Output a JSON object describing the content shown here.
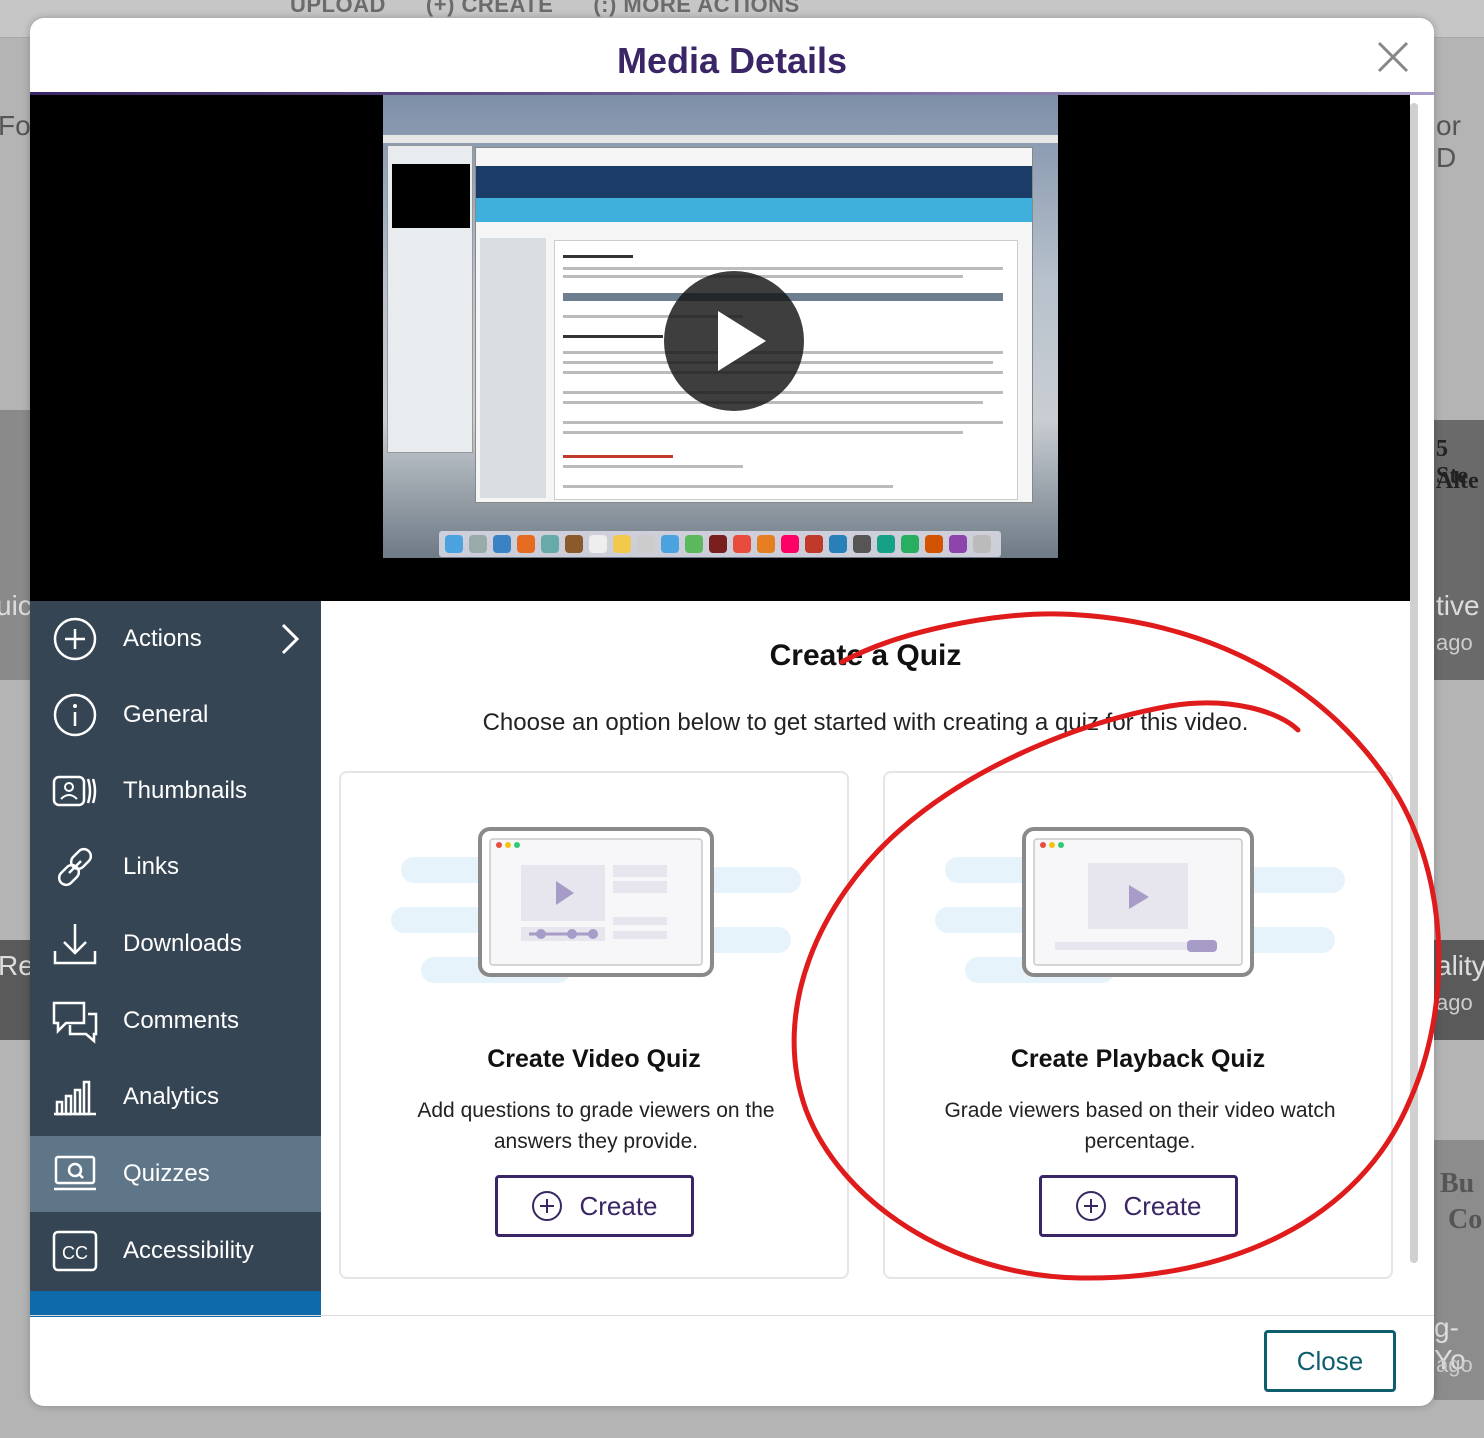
{
  "background": {
    "toolbar": [
      "UPLOAD",
      "(+) CREATE",
      "(:) MORE ACTIONS"
    ],
    "side_fragments_left": [
      "Fold",
      "uic",
      "Re"
    ],
    "side_fragments_right": [
      "or D",
      "5 Ste",
      "Alte",
      "tive",
      "ago",
      "ality",
      "ago",
      "Bu",
      "Co",
      "g-Yo",
      "ago"
    ]
  },
  "modal": {
    "title": "Media Details",
    "close_icon": "close-icon"
  },
  "player": {
    "play_icon": "play-icon"
  },
  "sidebar": {
    "items": [
      {
        "label": "Actions",
        "icon": "plus-circle-icon"
      },
      {
        "label": "General",
        "icon": "info-icon"
      },
      {
        "label": "Thumbnails",
        "icon": "thumbnails-icon"
      },
      {
        "label": "Links",
        "icon": "link-icon"
      },
      {
        "label": "Downloads",
        "icon": "download-icon"
      },
      {
        "label": "Comments",
        "icon": "comments-icon"
      },
      {
        "label": "Analytics",
        "icon": "analytics-icon"
      },
      {
        "label": "Quizzes",
        "icon": "quiz-icon"
      },
      {
        "label": "Accessibility",
        "icon": "cc-icon"
      }
    ],
    "active": "Quizzes"
  },
  "quiz": {
    "title": "Create a Quiz",
    "subtitle": "Choose an option below to get started with creating a quiz for this video.",
    "cards": [
      {
        "title": "Create Video Quiz",
        "description": "Add questions to grade viewers on the answers they provide.",
        "button": "Create"
      },
      {
        "title": "Create Playback Quiz",
        "description": "Grade viewers based on their video watch percentage.",
        "button": "Create"
      }
    ]
  },
  "footer": {
    "close_label": "Close"
  },
  "colors": {
    "brand_purple": "#3a2566",
    "sidebar_bg": "#364553",
    "sidebar_active": "#5f7688",
    "close_teal": "#0e5e6d",
    "annotation_red": "#e01b1b"
  }
}
